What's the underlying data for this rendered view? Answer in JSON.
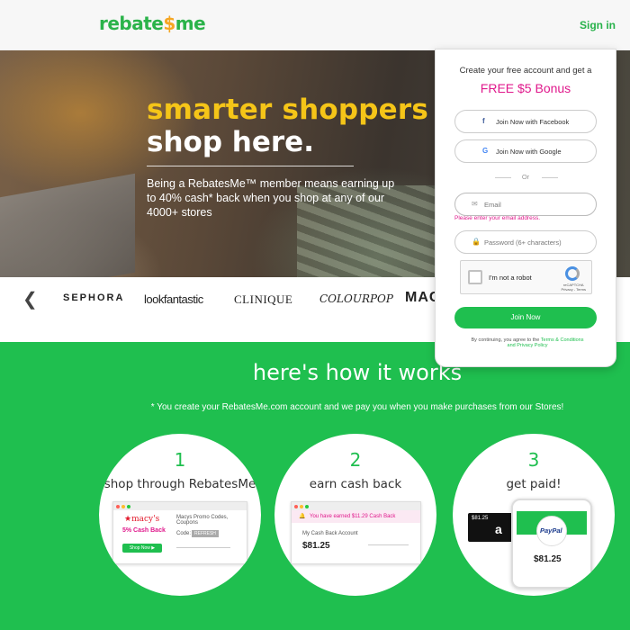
{
  "header": {
    "logo_prefix": "rebate",
    "logo_dollar": "$",
    "logo_suffix": "me",
    "signin": "Sign in"
  },
  "hero": {
    "title_line1": "smarter shoppers",
    "title_line2": "shop here.",
    "description": "Being a RebatesMe™ member means earning up to 40% cash* back when you shop at any of our 4000+ stores"
  },
  "brands": {
    "prev_icon": "chevron-left-icon",
    "items": [
      "SEPHORA",
      "lookfantastic",
      "CLINIQUE",
      "COLOURPOP",
      "MAC"
    ]
  },
  "signup": {
    "intro": "Create your free account and get a",
    "bonus": "FREE $5 Bonus",
    "facebook_label": "Join Now with Facebook",
    "google_label": "Join Now with Google",
    "or": "Or",
    "email_placeholder": "Email",
    "email_error": "Please enter your email address.",
    "password_placeholder": "Password (6+ characters)",
    "captcha_label": "I'm not a robot",
    "captcha_brand": "reCAPTCHA",
    "captcha_links": "Privacy - Terms",
    "join_label": "Join Now",
    "terms_prefix": "By continuing, you agree to the",
    "terms_link": "Terms & Conditions",
    "privacy_link": "and Privacy Policy"
  },
  "how": {
    "title": "here's how it works",
    "subtitle": "* You create your RebatesMe.com account and we pay you when you make purchases from our Stores!",
    "steps": [
      {
        "num": "1",
        "title": "shop through RebatesMe",
        "store": "★macy's",
        "cashback": "5% Cash Back",
        "shop_btn": "Shop Now ▶",
        "promo": "Macys Promo Codes, Coupons",
        "code_label": "Code:",
        "refresh": "REFRESH"
      },
      {
        "num": "2",
        "title": "earn cash back",
        "notice": "You have earned $11.29 Cash Back",
        "account_label": "My Cash Back Account",
        "amount": "$81.25"
      },
      {
        "num": "3",
        "title": "get paid!",
        "giftcard_amount": "$81.25",
        "paypal": "PayPal",
        "paid_amount": "$81.25"
      }
    ]
  },
  "colors": {
    "brand_green": "#1fbf4f",
    "accent_yellow": "#f5c518",
    "accent_pink": "#e0198c"
  }
}
